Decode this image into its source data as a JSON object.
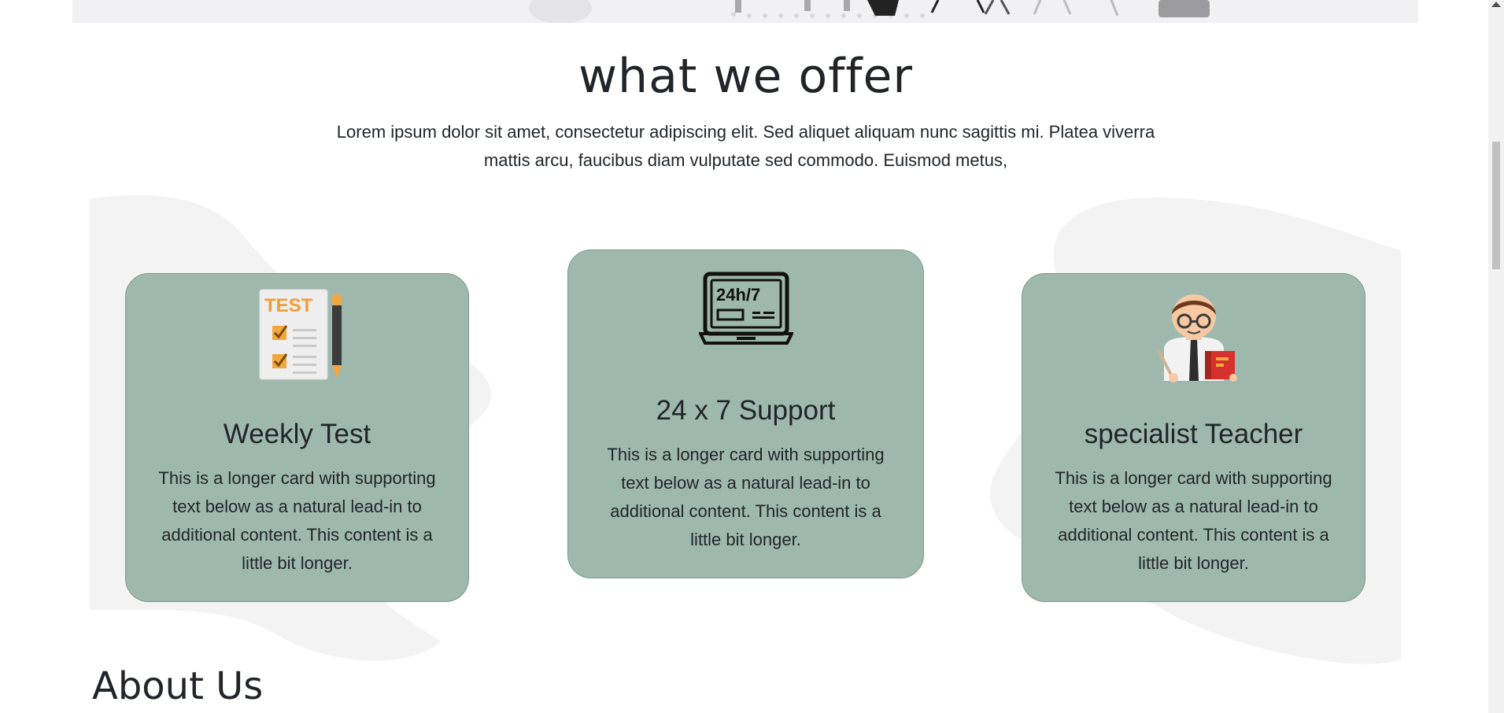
{
  "offer": {
    "title": "what we offer",
    "lead": "Lorem ipsum dolor sit amet, consectetur adipiscing elit. Sed aliquet aliquam nunc sagittis mi. Platea viverra mattis arcu, faucibus diam vulputate sed commodo. Euismod metus,",
    "cards": [
      {
        "icon": "test-checklist-icon",
        "icon_text": "TEST",
        "title": "Weekly Test",
        "text": "This is a longer card with supporting text below as a natural lead-in to additional content. This content is a little bit longer."
      },
      {
        "icon": "laptop-24h-icon",
        "icon_text": "24h/7",
        "title": "24 x 7 Support",
        "text": "This is a longer card with supporting text below as a natural lead-in to additional content. This content is a little bit longer."
      },
      {
        "icon": "teacher-icon",
        "title": "specialist Teacher",
        "text": "This is a longer card with supporting text below as a natural lead-in to additional content. This content is a little bit longer."
      }
    ]
  },
  "about": {
    "title": "About Us"
  },
  "colors": {
    "card_bg": "#9fb8ad",
    "blob": "#f3f3f3",
    "strip": "#f1f1f4"
  }
}
